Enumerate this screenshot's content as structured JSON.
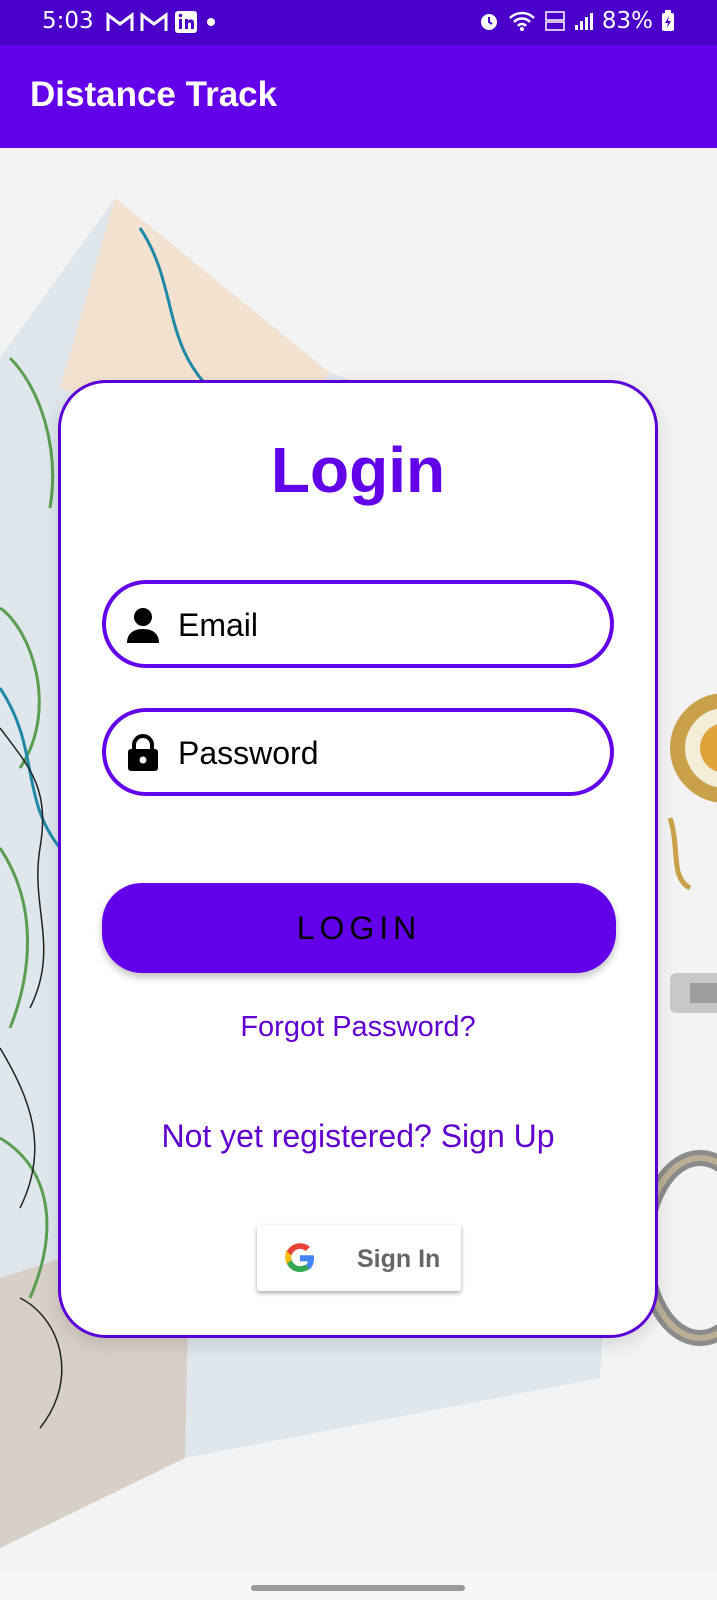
{
  "status_bar": {
    "time": "5:03",
    "battery": "83%",
    "notification_icons": [
      "gmail-icon",
      "gmail-icon",
      "linkedin-icon",
      "dot-icon"
    ]
  },
  "app_bar": {
    "title": "Distance Track"
  },
  "login_card": {
    "title": "Login",
    "email_placeholder": "Email",
    "password_placeholder": "Password",
    "login_button": "LOGIN",
    "forgot_password": "Forgot Password?",
    "signup_link": "Not yet registered? Sign Up",
    "google_button": "Sign In"
  },
  "colors": {
    "primary": "#6200ea",
    "status_bar": "#4a00c9",
    "card_border": "#5a00d6",
    "link": "#5f00d0"
  }
}
